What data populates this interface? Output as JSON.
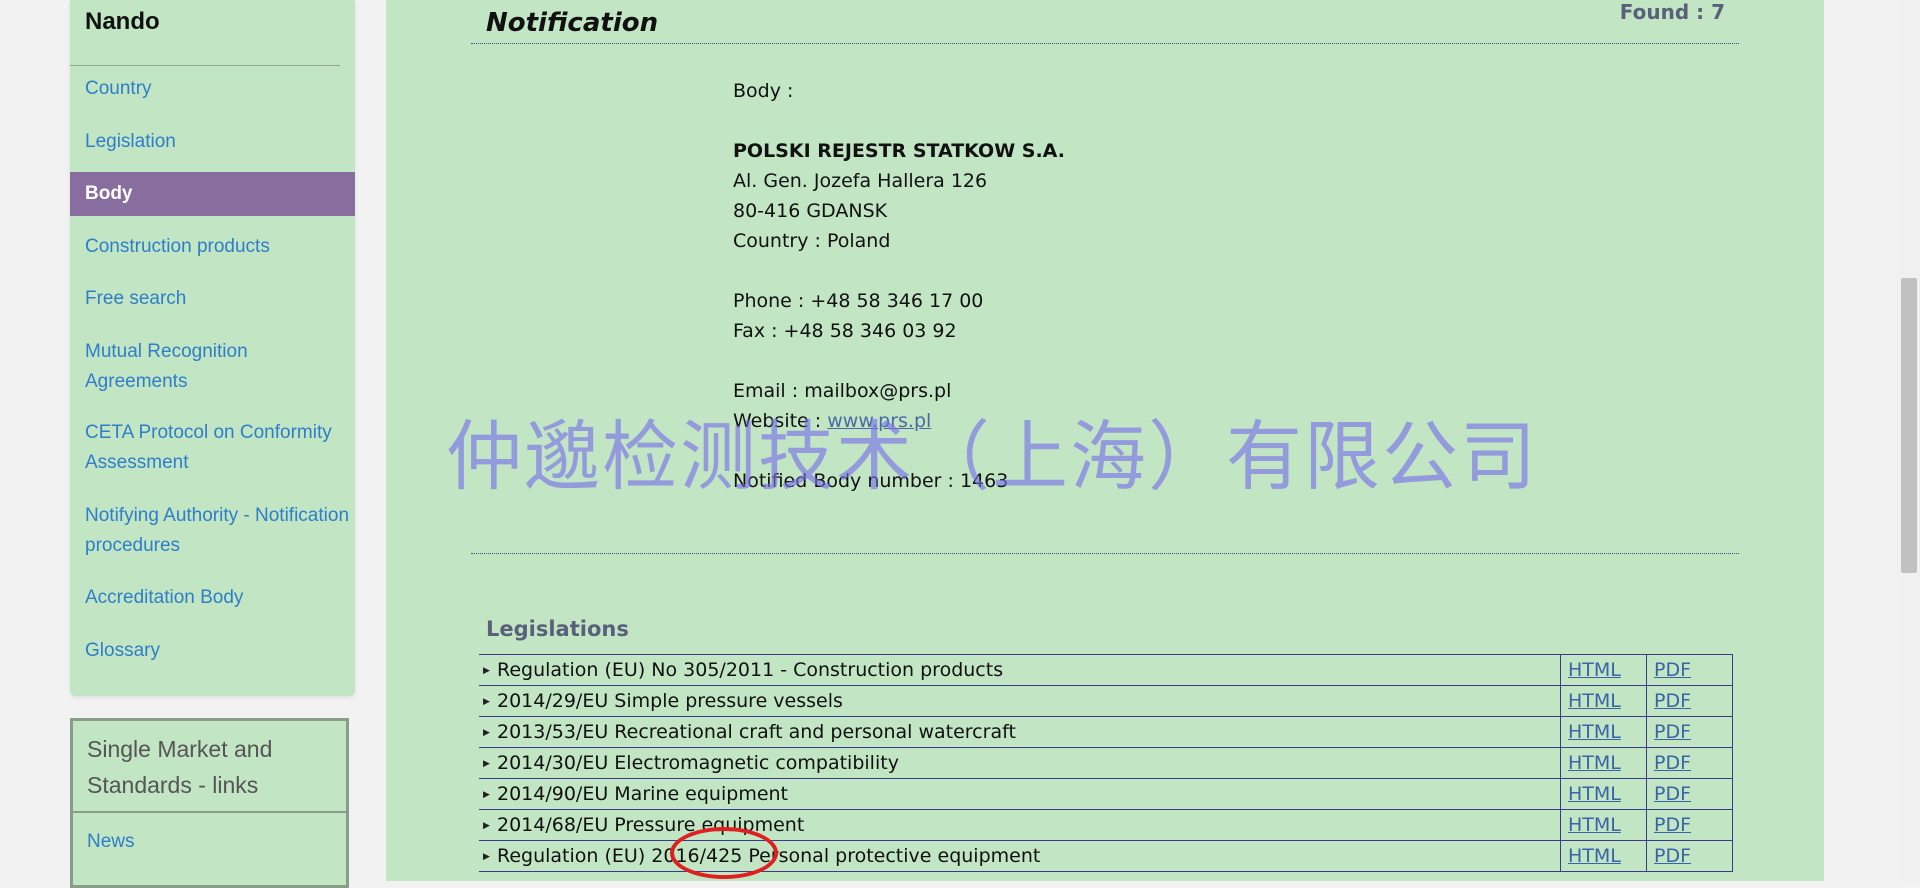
{
  "sidebar": {
    "title": "Nando",
    "items": [
      {
        "label": "Country"
      },
      {
        "label": "Legislation"
      },
      {
        "label": "Body"
      },
      {
        "label": "Construction products"
      },
      {
        "label": "Free search"
      },
      {
        "label": "Mutual Recognition Agreements"
      },
      {
        "label": "CETA Protocol on Conformity Assessment"
      },
      {
        "label": "Notifying Authority - Notification procedures"
      },
      {
        "label": "Accreditation Body"
      },
      {
        "label": "Glossary"
      }
    ],
    "active_item": "Body"
  },
  "links_box": {
    "title": "Single Market and Standards - links",
    "news": "News"
  },
  "main": {
    "section_title": "Notification",
    "found": "Found : 7",
    "body_label": "Body :",
    "body_name": "POLSKI REJESTR STATKOW S.A.",
    "address1": "Al. Gen. Jozefa Hallera 126",
    "address2": "80-416 GDANSK",
    "country": "Country : Poland",
    "phone": "Phone : +48 58 346 17 00",
    "fax": "Fax : +48 58 346 03 92",
    "email": "Email : mailbox@prs.pl",
    "website_label": "Website :",
    "website_link": "www.prs.pl",
    "nb_number": "Notified Body number : 1463"
  },
  "legislations": {
    "title": "Legislations",
    "html_label": "HTML",
    "pdf_label": "PDF",
    "rows": [
      "Regulation (EU) No 305/2011 - Construction products",
      "2014/29/EU Simple pressure vessels",
      "2013/53/EU Recreational craft and personal watercraft",
      "2014/30/EU Electromagnetic compatibility",
      "2014/90/EU Marine equipment",
      "2014/68/EU Pressure equipment",
      "Regulation (EU) 2016/425 Personal protective equipment"
    ]
  },
  "watermark": "仲邈检测技术（上海）有限公司",
  "colors": {
    "panel_bg": "#c2e5c4",
    "active_nav": "#876e9e",
    "link": "#2f7ec9",
    "annotation": "#e02020"
  }
}
